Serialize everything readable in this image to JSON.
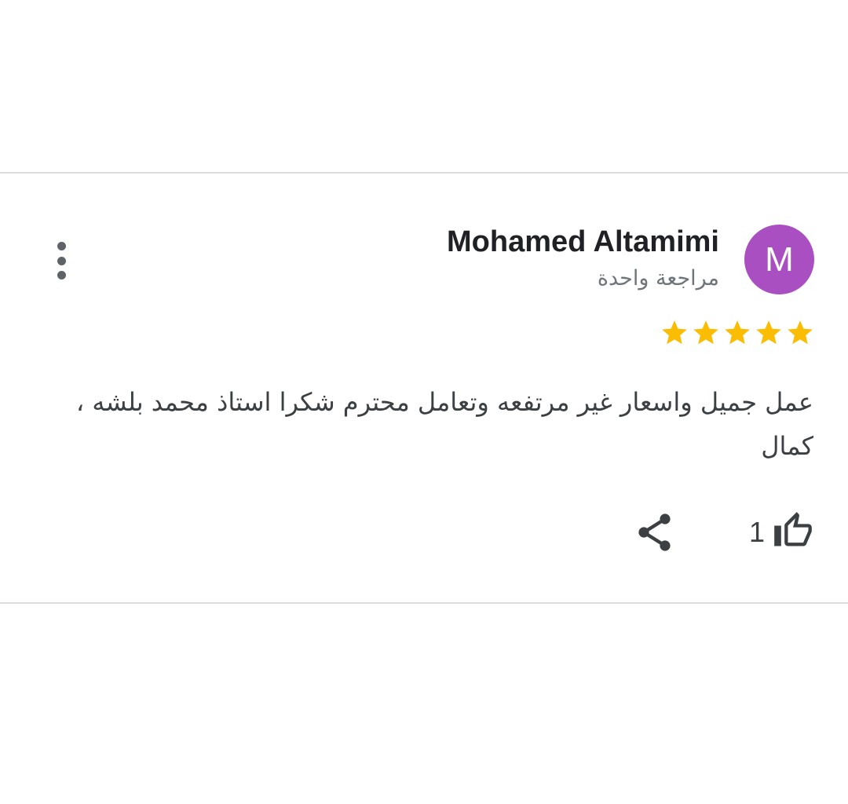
{
  "review": {
    "reviewer": {
      "name": "Mohamed Altamimi",
      "initial": "M",
      "avatar_color": "#a94fc2",
      "review_count_text": "مراجعة واحدة"
    },
    "rating": {
      "stars": 5,
      "max": 5,
      "star_color": "#fbbc04"
    },
    "text": "عمل جميل واسعار غير مرتفعه وتعامل محترم شكرا استاذ محمد بلشه ، كمال",
    "likes": "1",
    "icons": {
      "more": "more-vert-icon",
      "like": "thumb-up-icon",
      "share": "share-icon",
      "star": "star-icon"
    }
  }
}
